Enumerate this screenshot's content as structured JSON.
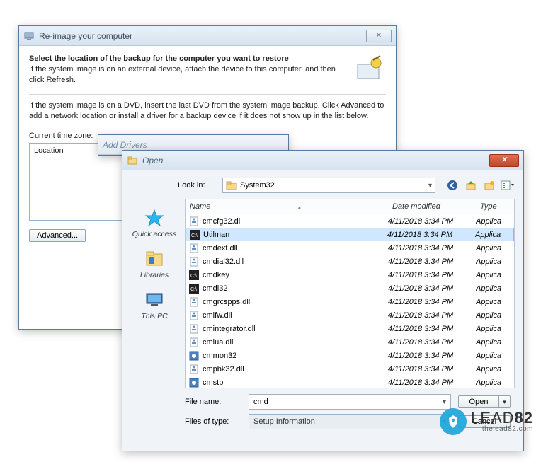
{
  "reimage": {
    "title": "Re-image your computer",
    "heading": "Select the location of the backup for the computer you want to restore",
    "subdesc": "If the system image is on an external device, attach the device to this computer, and then click Refresh.",
    "para": "If the system image is on a DVD, insert the last DVD from the system image backup. Click Advanced to add a network location or install a driver for a backup device if it does not show up in the list below.",
    "tz_label": "Current time zone:",
    "col_location": "Location",
    "advanced_btn": "Advanced..."
  },
  "adddrv": {
    "title": "Add Drivers"
  },
  "open": {
    "title": "Open",
    "lookin_label": "Look in:",
    "lookin_value": "System32",
    "places": {
      "quick": "Quick access",
      "libs": "Libraries",
      "pc": "This PC"
    },
    "cols": {
      "name": "Name",
      "date": "Date modified",
      "type": "Type"
    },
    "files": [
      {
        "icon": "dll",
        "name": "cmcfg32.dll",
        "date": "4/11/2018 3:34 PM",
        "type": "Applica",
        "sel": false
      },
      {
        "icon": "exe",
        "name": "Utilman",
        "date": "4/11/2018 3:34 PM",
        "type": "Applica",
        "sel": true
      },
      {
        "icon": "dll",
        "name": "cmdext.dll",
        "date": "4/11/2018 3:34 PM",
        "type": "Applica",
        "sel": false
      },
      {
        "icon": "dll",
        "name": "cmdial32.dll",
        "date": "4/11/2018 3:34 PM",
        "type": "Applica",
        "sel": false
      },
      {
        "icon": "exe",
        "name": "cmdkey",
        "date": "4/11/2018 3:34 PM",
        "type": "Applica",
        "sel": false
      },
      {
        "icon": "exe",
        "name": "cmdl32",
        "date": "4/11/2018 3:34 PM",
        "type": "Applica",
        "sel": false
      },
      {
        "icon": "dll",
        "name": "cmgrcspps.dll",
        "date": "4/11/2018 3:34 PM",
        "type": "Applica",
        "sel": false
      },
      {
        "icon": "dll",
        "name": "cmifw.dll",
        "date": "4/11/2018 3:34 PM",
        "type": "Applica",
        "sel": false
      },
      {
        "icon": "dll",
        "name": "cmintegrator.dll",
        "date": "4/11/2018 3:34 PM",
        "type": "Applica",
        "sel": false
      },
      {
        "icon": "dll",
        "name": "cmlua.dll",
        "date": "4/11/2018 3:34 PM",
        "type": "Applica",
        "sel": false
      },
      {
        "icon": "sys",
        "name": "cmmon32",
        "date": "4/11/2018 3:34 PM",
        "type": "Applica",
        "sel": false
      },
      {
        "icon": "dll",
        "name": "cmpbk32.dll",
        "date": "4/11/2018 3:34 PM",
        "type": "Applica",
        "sel": false
      },
      {
        "icon": "sys",
        "name": "cmstp",
        "date": "4/11/2018 3:34 PM",
        "type": "Applica",
        "sel": false
      }
    ],
    "filename_label": "File name:",
    "filename_value": "cmd",
    "filetype_label": "Files of type:",
    "filetype_value": "Setup Information",
    "open_btn": "Open",
    "cancel_btn": "Cancel"
  },
  "watermark": {
    "brand_light": "LEAD",
    "brand_bold": "82",
    "sub": "thelead82.com"
  }
}
